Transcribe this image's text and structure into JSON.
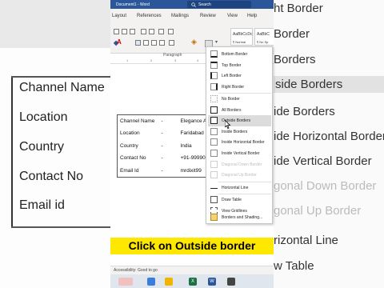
{
  "word": {
    "title": "Document1 - Word",
    "search_placeholder": "Search",
    "tabs": [
      "Layout",
      "References",
      "Mailings",
      "Review",
      "View",
      "Help"
    ],
    "paragraph_group_label": "Paragraph",
    "styles": [
      {
        "preview": "AaBbCcDc",
        "name": "¶ Normal"
      },
      {
        "preview": "AaBbC",
        "name": "¶ No Sp"
      }
    ],
    "ruler": [
      "1",
      "2",
      "3",
      "4"
    ],
    "status": "Accessibility: Good to go"
  },
  "table": {
    "rows": [
      {
        "label": "Channel Name",
        "sep": "-",
        "value": "Elegance A"
      },
      {
        "label": "Location",
        "sep": "-",
        "value": "Faridabad"
      },
      {
        "label": "Country",
        "sep": "-",
        "value": "India"
      },
      {
        "label": "Contact No",
        "sep": "-",
        "value": "+91-99990"
      },
      {
        "label": "Email Id",
        "sep": "-",
        "value": "mrdixit99"
      }
    ]
  },
  "menu": {
    "items": [
      {
        "label": "Bottom Border",
        "disabled": false
      },
      {
        "label": "Top Border",
        "disabled": false
      },
      {
        "label": "Left Border",
        "disabled": false
      },
      {
        "label": "Right Border",
        "disabled": false
      },
      {
        "label": "No Border",
        "disabled": false
      },
      {
        "label": "All Borders",
        "disabled": false
      },
      {
        "label": "Outside Borders",
        "disabled": false,
        "highlighted": true
      },
      {
        "label": "Inside Borders",
        "disabled": false
      },
      {
        "label": "Inside Horizontal Border",
        "disabled": false
      },
      {
        "label": "Inside Vertical Border",
        "disabled": false
      },
      {
        "label": "Diagonal Down Border",
        "disabled": true
      },
      {
        "label": "Diagonal Up Border",
        "disabled": true
      },
      {
        "label": "Horizontal Line",
        "disabled": false
      },
      {
        "label": "Draw Table",
        "disabled": false
      },
      {
        "label": "View Gridlines",
        "disabled": false
      },
      {
        "label": "Borders and Shading...",
        "disabled": false
      }
    ]
  },
  "left_background": {
    "rows": [
      "Channel Name",
      "Location",
      "Country",
      "Contact No",
      "Email id"
    ]
  },
  "right_background": {
    "items": [
      "ht Border",
      "Border",
      "Borders",
      "side Borders",
      "ide Borders",
      "ide Horizontal Border",
      "ide Vertical Border",
      "gonal Down Border",
      "gonal Up Border",
      "rizontal Line",
      "w Table"
    ]
  },
  "caption": "Click on Outside border",
  "colors": {
    "word_blue": "#2b579a",
    "caption_bg": "#ffe800",
    "menu_highlight": "#dcdcdc"
  }
}
